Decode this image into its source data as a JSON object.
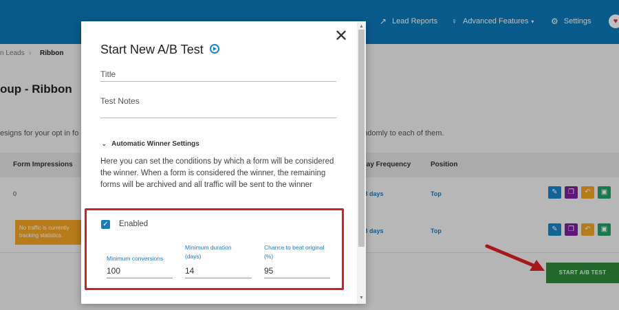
{
  "nav": {
    "lead_reports": "Lead Reports",
    "advanced_features": "Advanced Features",
    "settings": "Settings"
  },
  "breadcrumb": {
    "parent": "n Leads",
    "separator": "›",
    "current": "Ribbon"
  },
  "page": {
    "title": "oup - Ribbon",
    "description": "esigns for your opt in fo",
    "description_right": "andomly to each of them."
  },
  "table": {
    "headers": {
      "impressions": "Form Impressions",
      "frequency": "lay Frequency",
      "position": "Position"
    },
    "rows": [
      {
        "impressions": "0",
        "frequency": "y 8 days",
        "position": "Top"
      },
      {
        "warning": "No traffic is currently tracking statistics.",
        "frequency": "y 8 days",
        "position": "Top"
      }
    ]
  },
  "start_button": "START A/B TEST",
  "modal": {
    "title": "Start New A/B Test",
    "close": "✕",
    "title_placeholder": "Title",
    "notes_placeholder": "Test Notes",
    "auto_winner_heading": "Automatic Winner Settings",
    "auto_winner_desc": "Here you can set the conditions by which a form will be considered the winner. When a form is considered the winner, the remaining forms will be archived and all traffic will be sent to the winner",
    "enabled_label": "Enabled",
    "min_conversions_label": "Minimum conversions",
    "min_conversions_value": "100",
    "min_duration_label": "Minimum duration (days)",
    "min_duration_value": "14",
    "chance_label": "Chance to beat original (%)",
    "chance_value": "95"
  },
  "colors": {
    "brand": "#0b79b8",
    "highlight": "#d21f1f",
    "start_button": "#2e8b3a",
    "accent": "#1a7dbc"
  }
}
